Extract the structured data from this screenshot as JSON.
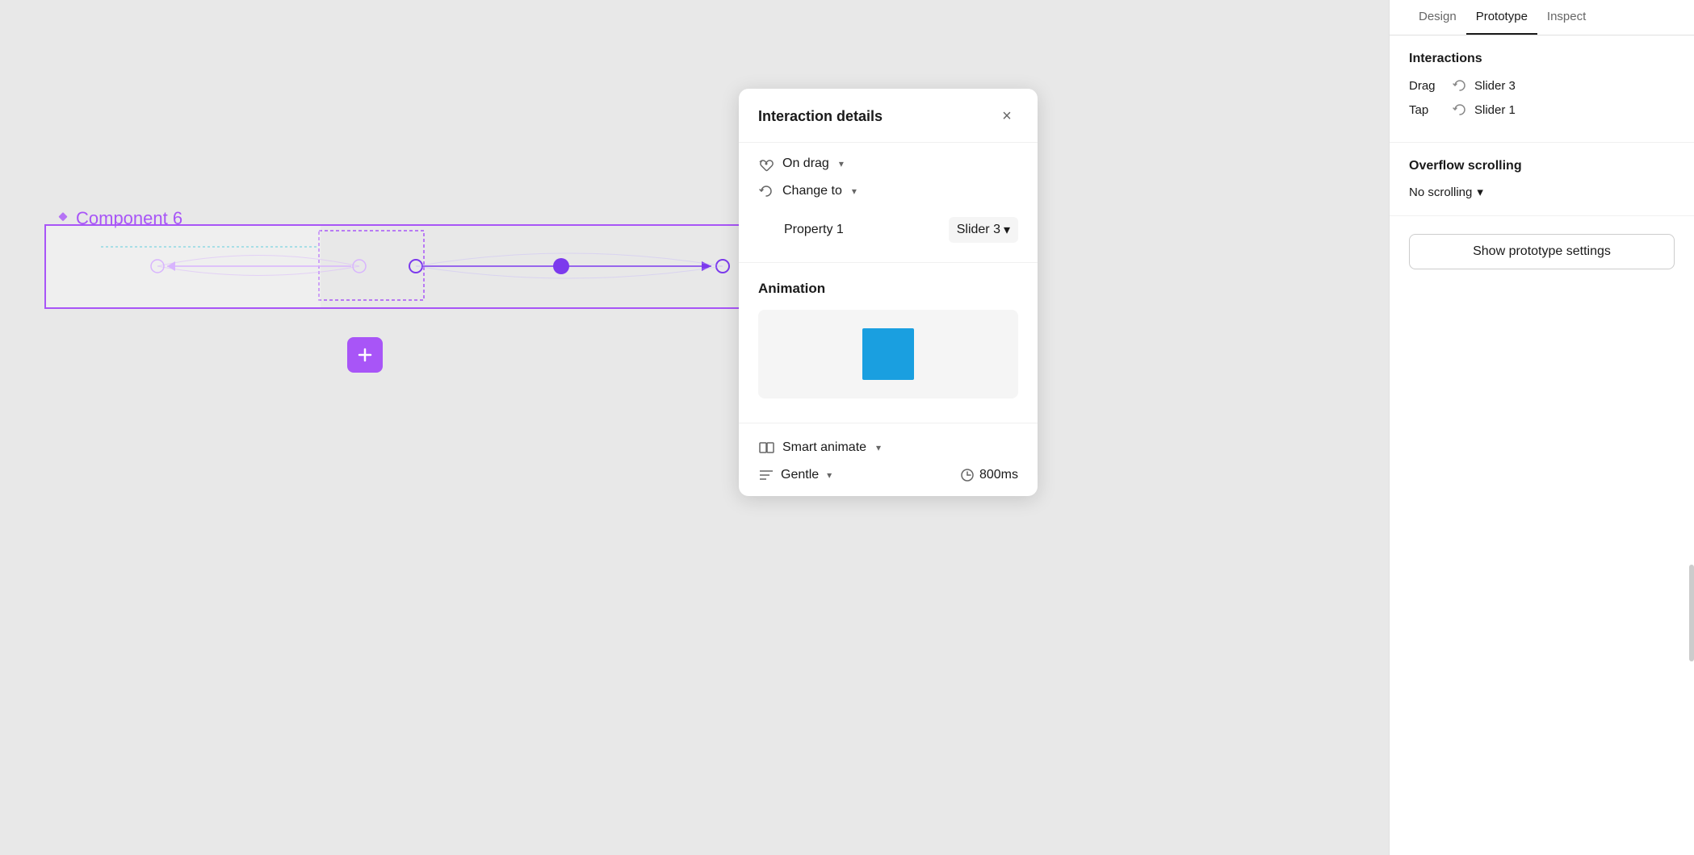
{
  "canvas": {
    "background": "#e8e8e8",
    "component_label": "Component 6"
  },
  "interaction_panel": {
    "title": "Interaction details",
    "close_label": "×",
    "trigger": {
      "label": "On drag",
      "icon": "drag-icon"
    },
    "change_to": {
      "label": "Change to",
      "icon": "change-icon"
    },
    "property": {
      "label": "Property 1",
      "value": "Slider 3"
    },
    "animation": {
      "title": "Animation",
      "smart_animate_label": "Smart animate",
      "gentle_label": "Gentle",
      "duration": "800ms"
    }
  },
  "right_panel": {
    "tabs": [
      "Design",
      "Prototype",
      "Inspect"
    ],
    "active_tab": "Prototype",
    "interactions_title": "Interactions",
    "interactions": [
      {
        "trigger": "Drag",
        "target": "Slider 3"
      },
      {
        "trigger": "Tap",
        "target": "Slider 1"
      }
    ],
    "overflow_title": "Overflow scrolling",
    "overflow_value": "No scrolling",
    "show_prototype_btn": "Show prototype settings"
  },
  "add_button": {
    "icon": "plus-icon"
  }
}
